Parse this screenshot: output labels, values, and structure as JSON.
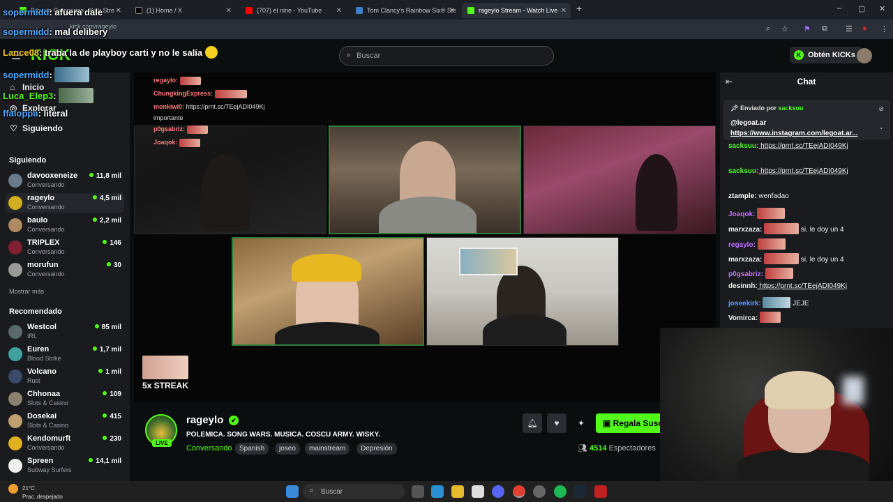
{
  "browser": {
    "tabs": [
      {
        "title": "Browse Categories - Kick Stre"
      },
      {
        "title": "(1) Home / X"
      },
      {
        "title": "(707) el nine - YouTube"
      },
      {
        "title": "Tom Clancy's Rainbow Six® Sie"
      },
      {
        "title": "rageylo Stream - Watch Live"
      }
    ],
    "url": "kick.com/rageylo",
    "new_tab": "+"
  },
  "overlay_chat": [
    {
      "user": "sopermidd",
      "text": " afuera dale"
    },
    {
      "user": "sopermidd",
      "text": " mal delibery"
    },
    {
      "user": "Lance08",
      "text": " traba la de playboy carti y no le salía"
    },
    {
      "user": "sopermidd",
      "text": ""
    },
    {
      "user": "Luca_Elep3",
      "text": ""
    },
    {
      "user": "ffaloppa",
      "text": " literal"
    }
  ],
  "header": {
    "logo": "KICK",
    "search_placeholder": "Buscar",
    "kicks_button": "Obtén KICKs"
  },
  "sidebar": {
    "nav": [
      {
        "label": "Inicio"
      },
      {
        "label": "Explorar"
      },
      {
        "label": "Siguiendo"
      }
    ],
    "following_title": "Siguiendo",
    "following": [
      {
        "name": "davooxeneize",
        "category": "Conversando",
        "viewers": "11,8 mil"
      },
      {
        "name": "rageylo",
        "category": "Conversando",
        "viewers": "4,5 mil"
      },
      {
        "name": "baulo",
        "category": "Conversando",
        "viewers": "2,2 mil"
      },
      {
        "name": "TRIPLEX",
        "category": "Conversando",
        "viewers": "146"
      },
      {
        "name": "morufun",
        "category": "Conversando",
        "viewers": "30"
      }
    ],
    "show_more": "Mostrar más",
    "recommended_title": "Recomendado",
    "recommended": [
      {
        "name": "Westcol",
        "category": "IRL",
        "viewers": "85 mil"
      },
      {
        "name": "Euren",
        "category": "Blood Strike",
        "viewers": "1,7 mil"
      },
      {
        "name": "Volcano",
        "category": "Rust",
        "viewers": "1 mil"
      },
      {
        "name": "Chhonaa",
        "category": "Slots & Casino",
        "viewers": "109"
      },
      {
        "name": "Dosekai",
        "category": "Slots & Casino",
        "viewers": "415"
      },
      {
        "name": "Kendomurft",
        "category": "Conversando",
        "viewers": "230"
      },
      {
        "name": "Spreen",
        "category": "Subway Surfers",
        "viewers": "14,1 mil"
      }
    ]
  },
  "video": {
    "inner_chat": [
      {
        "user": "regaylo:",
        "text": ""
      },
      {
        "user": "ChungkingExpress:",
        "text": ""
      },
      {
        "user": "monkiwi0:",
        "text": " https://prnt.sc/TEejADI049Kj"
      },
      {
        "user": "",
        "text": "importante"
      },
      {
        "user": "p0gsabriz:",
        "text": ""
      },
      {
        "user": "Joaqok:",
        "text": ""
      }
    ],
    "streak": "5x STREAK"
  },
  "stream": {
    "channel": "rageylo",
    "live": "LIVE",
    "verified_mark": "✔",
    "title": "POLEMICA. SONG WARS. MUSICA. COSCU ARMY. WISKY.",
    "category": "Conversando",
    "tags": [
      "Spanish",
      "joseo",
      "mainstream",
      "Depresión"
    ],
    "subscribe_button": "Regala Suscripciones",
    "viewers_count": "4514",
    "viewers_label": "Espectadores"
  },
  "chat": {
    "title": "Chat",
    "pinned_by_label": "Enviado por",
    "pinned_by_user": "sacksuu",
    "pinned_lines": [
      "@legoat.ar",
      "https://www.instagram.com/legoat.ar..."
    ],
    "messages": [
      {
        "user": "sacksuu:",
        "text": " https://prnt.sc/TEejADI049Kj",
        "color": "#53fc18"
      },
      {
        "user": "sacksuu:",
        "text": " https://prnt.sc/TEejADI049Kj",
        "color": "#53fc18"
      },
      {
        "user": "ztample:",
        "text": " wenfadao",
        "color": "#ffffff"
      },
      {
        "user": "Joaqok:",
        "text": "",
        "color": "#c070ff"
      },
      {
        "user": "marxzaza:",
        "text": " si. le doy un 4",
        "color": "#e8e8e8"
      },
      {
        "user": "regaylo:",
        "text": "",
        "color": "#c070ff"
      },
      {
        "user": "marxzaza:",
        "text": " si. le doy un 4",
        "color": "#e8e8e8"
      },
      {
        "user": "p0gsabriz:",
        "text": "",
        "color": "#c070ff"
      },
      {
        "user": "desinnh:",
        "text": " https://prnt.sc/TEejADI049Kj",
        "color": "#e8e8e8"
      },
      {
        "user": "joseekirk:",
        "text": " JEJE",
        "color": "#6a9aff"
      },
      {
        "user": "Vomirca:",
        "text": "",
        "color": "#e8e8e8"
      }
    ]
  },
  "taskbar": {
    "temp": "21°C",
    "weather": "Prac. despejado",
    "search": "Buscar"
  },
  "colors": {
    "accent": "#53fc18",
    "background": "#0b0e0f",
    "panel": "#191b1f"
  }
}
